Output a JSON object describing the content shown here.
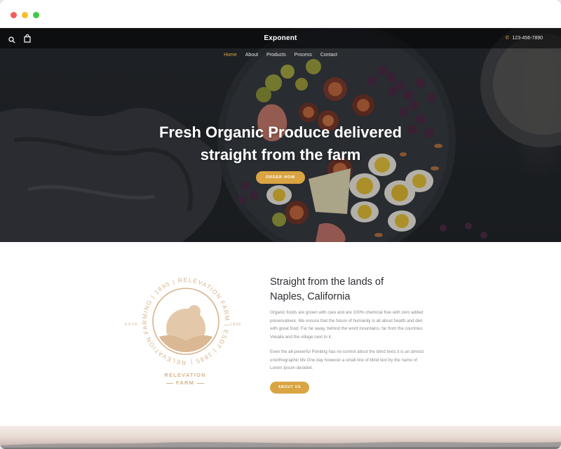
{
  "window": {
    "controls": [
      "close",
      "minimize",
      "maximize"
    ]
  },
  "nav": {
    "brand": "Exponent",
    "phone": "123-456-7890",
    "items": [
      {
        "label": "Home",
        "active": true
      },
      {
        "label": "About",
        "active": false
      },
      {
        "label": "Products",
        "active": false
      },
      {
        "label": "Process",
        "active": false
      },
      {
        "label": "Contact",
        "active": false
      }
    ],
    "icons": [
      "search-icon",
      "cart-icon",
      "phone-icon"
    ]
  },
  "hero": {
    "title_line1": "Fresh Organic Produce delivered",
    "title_line2": "straight from the farm",
    "cta": "Order Now"
  },
  "about": {
    "heading_line1": "Straight from the lands of",
    "heading_line2": "Naples, California",
    "paragraph1": "Organic foods are grown with care and are 100% chemical free with zero added preservatives. We ensure that the future of humanity is all about health and diet  with great food. Far far away, behind the word mountains, far from the countries Vokalia and the village next to it.",
    "paragraph2": "Even the all-powerful Pointing has no control about the blind texts it is an almost unorthographic life One day however a small line of blind text by the name of Lorem Ipsum decided.",
    "button": "About Us"
  },
  "badge": {
    "ring_text": "RELEVATION FARMING | 1895 | RELEVATION FARM | ESDT | 1895 |",
    "estd": "ESTD",
    "year": "1895",
    "name": "RELEVATION",
    "sub": "FARM"
  },
  "colors": {
    "accent": "#d9a441",
    "badge": "#d6b48d",
    "heading": "#2c2f34",
    "body_text": "#8c8c8c"
  }
}
